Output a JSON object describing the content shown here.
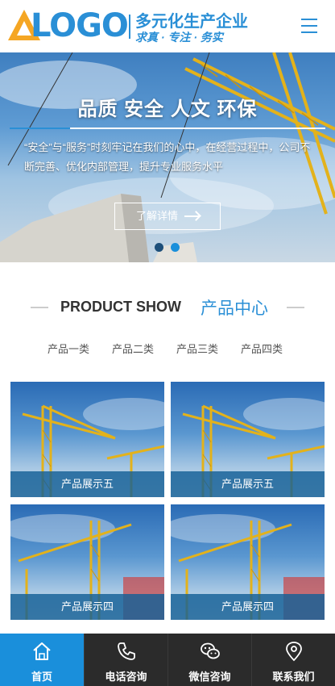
{
  "header": {
    "logo_word": "LOGO",
    "logo_title": "多元化生产企业",
    "logo_slogan": "求真 · 专注 · 务实",
    "brand_color": "#2a8fd6",
    "logo_mark_color": "#f5a623",
    "menu_icon": "hamburger-menu-icon"
  },
  "banner": {
    "title": "品质 安全 人文 环保",
    "text": "“安全”与“服务”时刻牢记在我们的心中，在经营过程中，公司不断完善、优化内部管理，提升专业服务水平",
    "button_label": "了解详情",
    "slides_total": 2,
    "active_slide": 2
  },
  "products": {
    "heading_en": "PRODUCT SHOW",
    "heading_cn": "产品中心",
    "tabs": [
      "产品一类",
      "产品二类",
      "产品三类",
      "产品四类"
    ],
    "items": [
      {
        "caption": "产品展示五"
      },
      {
        "caption": "产品展示五"
      },
      {
        "caption": "产品展示四"
      },
      {
        "caption": "产品展示四"
      }
    ]
  },
  "footer": {
    "active_color": "#1a8fdb",
    "items": [
      {
        "label": "首页",
        "icon": "home-icon"
      },
      {
        "label": "电话咨询",
        "icon": "phone-icon"
      },
      {
        "label": "微信咨询",
        "icon": "wechat-icon"
      },
      {
        "label": "联系我们",
        "icon": "location-pin-icon"
      }
    ]
  }
}
